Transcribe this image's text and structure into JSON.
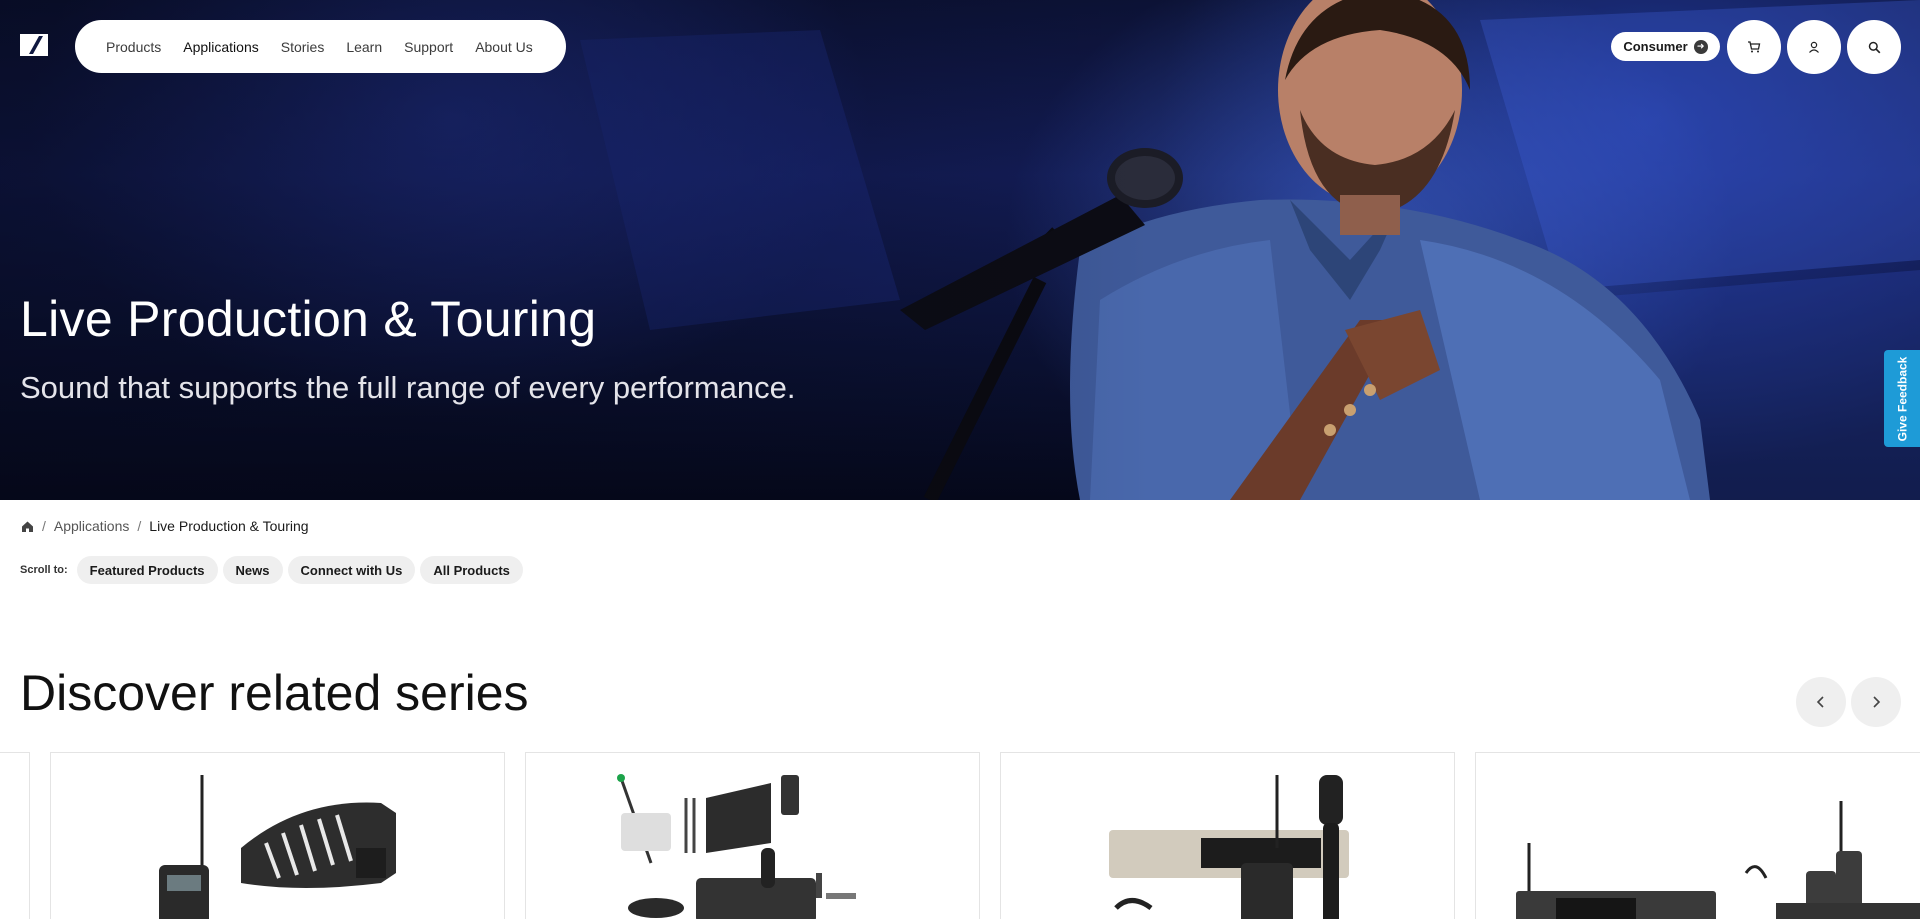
{
  "nav": {
    "items": [
      {
        "label": "Products"
      },
      {
        "label": "Applications"
      },
      {
        "label": "Stories"
      },
      {
        "label": "Learn"
      },
      {
        "label": "Support"
      },
      {
        "label": "About Us"
      }
    ],
    "active": "Applications"
  },
  "header": {
    "consumer_label": "Consumer",
    "icons": [
      "cart-icon",
      "user-icon",
      "search-icon"
    ]
  },
  "hero": {
    "title": "Live Production & Touring",
    "subtitle": "Sound that supports the full range of every performance."
  },
  "feedback": {
    "label": "Give Feedback",
    "color": "#1e9bd7"
  },
  "breadcrumb": {
    "items": [
      "Applications",
      "Live Production & Touring"
    ]
  },
  "scroll_to": {
    "label": "Scroll to:",
    "links": [
      "Featured Products",
      "News",
      "Connect with Us",
      "All Products"
    ]
  },
  "section": {
    "title": "Discover related series"
  },
  "colors": {
    "hero_blue": "#1a2a7a",
    "pill_bg": "#efefef",
    "text": "#1a1a1a"
  }
}
